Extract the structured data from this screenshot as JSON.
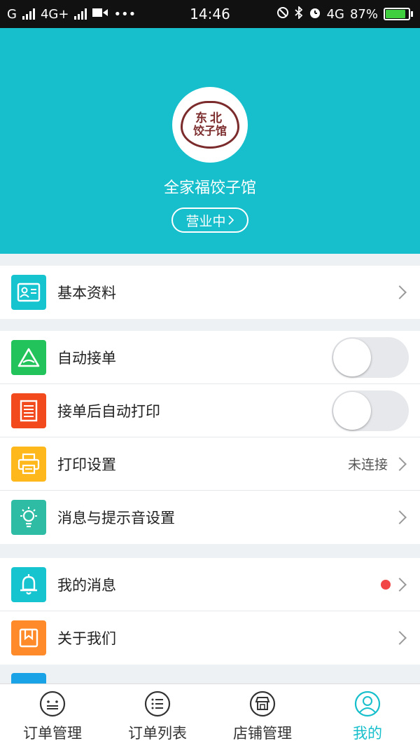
{
  "status_bar": {
    "carrier1": "G",
    "network": "4G+",
    "time": "14:46",
    "network2": "4G",
    "battery": "87%",
    "battery_level": 0.87
  },
  "header": {
    "logo_line1": "东北",
    "logo_line2": "饺子馆",
    "shop_name": "全家福饺子馆",
    "status": "营业中"
  },
  "groups": [
    [
      {
        "label": "基本资料",
        "icon": "id-card-icon",
        "color": "#16c4d0"
      }
    ],
    [
      {
        "label": "自动接单",
        "icon": "triangle-logo-icon",
        "color": "#22c35a",
        "toggle": false
      },
      {
        "label": "接单后自动打印",
        "icon": "receipt-icon",
        "color": "#f24a1d",
        "toggle": false
      },
      {
        "label": "打印设置",
        "icon": "printer-icon",
        "color": "#ffb81c",
        "value": "未连接"
      },
      {
        "label": "消息与提示音设置",
        "icon": "bulb-icon",
        "color": "#2ebda4"
      }
    ],
    [
      {
        "label": "我的消息",
        "icon": "bell-icon",
        "color": "#16c4d0",
        "badge": true
      },
      {
        "label": "关于我们",
        "icon": "bookmark-icon",
        "color": "#ff8a2a"
      }
    ]
  ],
  "tabs": [
    {
      "label": "订单管理",
      "icon": "order-manage-icon",
      "active": false
    },
    {
      "label": "订单列表",
      "icon": "order-list-icon",
      "active": false
    },
    {
      "label": "店铺管理",
      "icon": "store-icon",
      "active": false
    },
    {
      "label": "我的",
      "icon": "profile-icon",
      "active": true
    }
  ],
  "colors": {
    "accent": "#16bfcb",
    "badge": "#f24545"
  }
}
